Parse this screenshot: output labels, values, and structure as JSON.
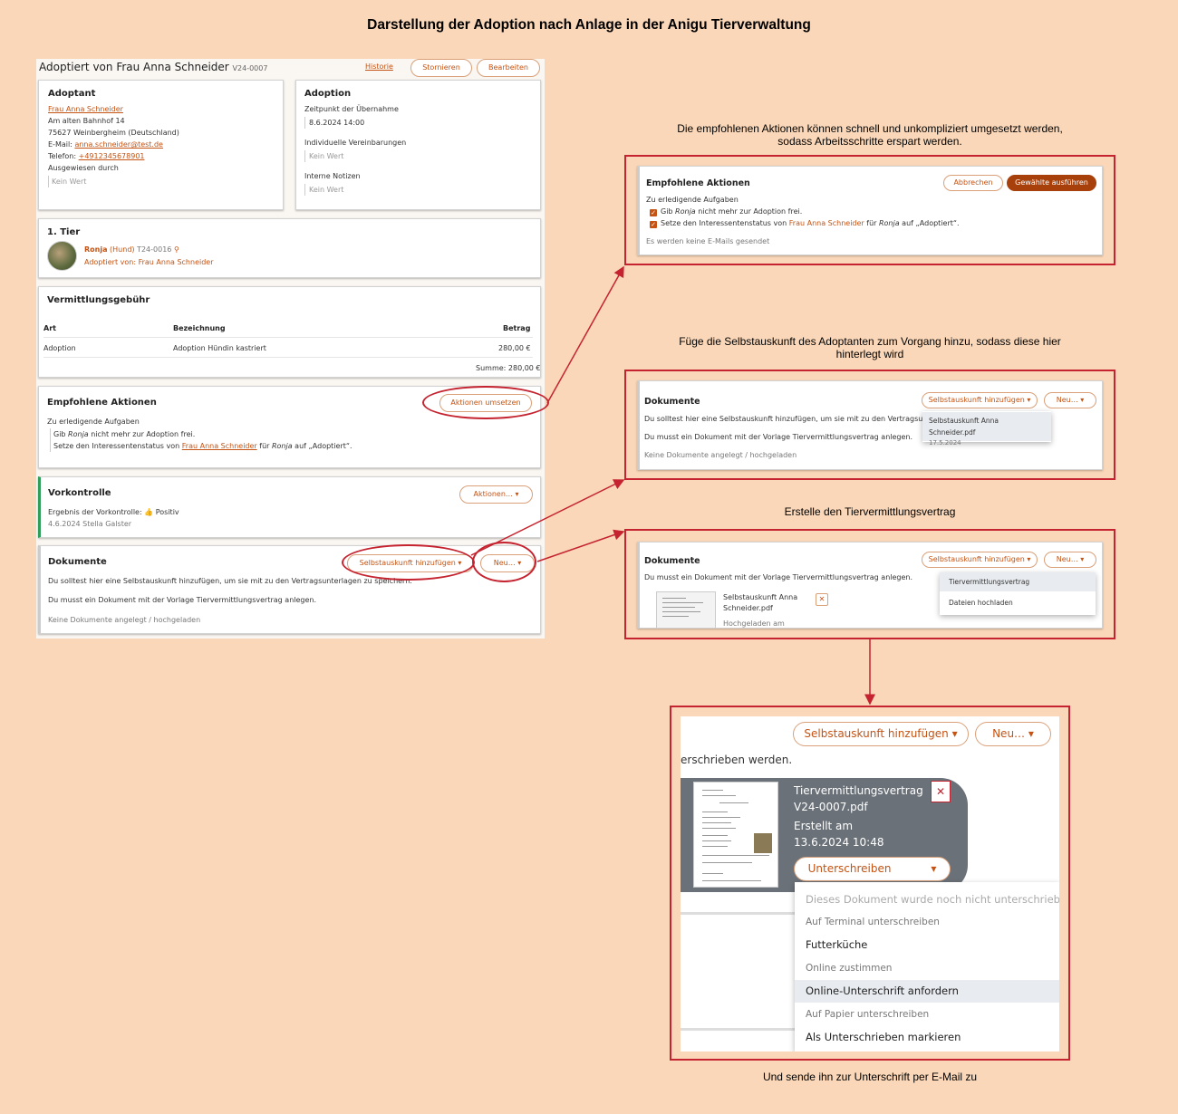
{
  "title": "Darstellung der Adoption nach Anlage in der Anigu Tierverwaltung",
  "main": {
    "heading": "Adoptiert von Frau Anna Schneider",
    "record_id": "V24-0007",
    "link_history": "Historie",
    "btn_cancel": "Stornieren",
    "btn_edit": "Bearbeiten",
    "adopter": {
      "title": "Adoptant",
      "name": "Frau Anna Schneider",
      "street": "Am alten Bahnhof 14",
      "city": "75627 Weinbergheim (Deutschland)",
      "email_label": "E-Mail:",
      "email": "anna.schneider@test.de",
      "phone_label": "Telefon:",
      "phone": "+4912345678901",
      "id_label": "Ausgewiesen durch",
      "id_value": "Kein Wert"
    },
    "adoption": {
      "title": "Adoption",
      "time_label": "Zeitpunkt der Übernahme",
      "time_value": "8.6.2024 14:00",
      "agreements_label": "Individuelle Vereinbarungen",
      "agreements_value": "Kein Wert",
      "notes_label": "Interne Notizen",
      "notes_value": "Kein Wert"
    },
    "animal": {
      "title": "1. Tier",
      "name": "Ronja",
      "species": "(Hund)",
      "id": "T24-0016",
      "adopted_by": "Adoptiert von: Frau Anna Schneider"
    },
    "fee": {
      "title": "Vermittlungsgebühr",
      "col_type": "Art",
      "col_desc": "Bezeichnung",
      "col_amount": "Betrag",
      "row_type": "Adoption",
      "row_desc": "Adoption Hündin kastriert",
      "row_amount": "280,00 €",
      "sum": "Summe: 280,00 €"
    },
    "recommended": {
      "title": "Empfohlene Aktionen",
      "btn": "Aktionen umsetzen",
      "tasks_label": "Zu erledigende Aufgaben",
      "task1_pre": "Gib ",
      "task1_em": "Ronja",
      "task1_post": " nicht mehr zur Adoption frei.",
      "task2_pre": "Setze den Interessentenstatus von ",
      "task2_link": "Frau Anna Schneider",
      "task2_mid": " für ",
      "task2_em": "Ronja",
      "task2_post": " auf „Adoptiert“."
    },
    "precheck": {
      "title": "Vorkontrolle",
      "btn": "Aktionen…",
      "result_label": "Ergebnis der Vorkontrolle:",
      "result_value": "Positiv",
      "meta": "4.6.2024 Stella Galster"
    },
    "documents": {
      "title": "Dokumente",
      "btn_self": "Selbstauskunft hinzufügen",
      "btn_new": "Neu…",
      "hint1": "Du solltest hier eine Selbstauskunft hinzufügen, um sie mit zu den Vertragsunterlagen zu speichern.",
      "hint2": "Du musst ein Dokument mit der Vorlage Tiervermittlungsvertrag anlegen.",
      "empty": "Keine Dokumente angelegt / hochgeladen"
    }
  },
  "callout1": {
    "caption": "Die empfohlenen Aktionen können schnell und unkompliziert umgesetzt werden, sodass Arbeitsschritte erspart werden.",
    "title": "Empfohlene Aktionen",
    "btn_abort": "Abbrechen",
    "btn_run": "Gewählte ausführen",
    "tasks_label": "Zu erledigende Aufgaben",
    "task1_pre": "Gib ",
    "task1_em": "Ronja",
    "task1_post": " nicht mehr zur Adoption frei.",
    "task2_pre": "Setze den Interessentenstatus von ",
    "task2_link": "Frau Anna Schneider",
    "task2_mid": " für ",
    "task2_em": "Ronja",
    "task2_post": " auf „Adoptiert“.",
    "no_mail": "Es werden keine E-Mails gesendet"
  },
  "callout2": {
    "caption": "Füge die Selbstauskunft des Adoptanten zum Vorgang hinzu, sodass diese hier hinterlegt wird",
    "title": "Dokumente",
    "btn_self": "Selbstauskunft hinzufügen",
    "btn_new": "Neu…",
    "hint1": "Du solltest hier eine Selbstauskunft hinzufügen, um sie mit zu den Vertragsunterlage",
    "hint2": "Du musst ein Dokument mit der Vorlage Tiervermittlungsvertrag anlegen.",
    "empty": "Keine Dokumente angelegt / hochgeladen",
    "dd_file": "Selbstauskunft Anna Schneider.pdf",
    "dd_date": "17.5.2024"
  },
  "callout3": {
    "caption": "Erstelle den Tiervermittlungsvertrag",
    "title": "Dokumente",
    "btn_self": "Selbstauskunft hinzufügen",
    "btn_new": "Neu…",
    "hint": "Du musst ein Dokument mit der Vorlage Tiervermittlungsvertrag anlegen.",
    "file_name": "Selbstauskunft Anna Schneider.pdf",
    "uploaded": "Hochgeladen am",
    "dd_item1": "Tiervermittlungsvertrag",
    "dd_item2": "Dateien hochladen"
  },
  "callout4": {
    "caption": "Und sende ihn zur Unterschrift per E-Mail zu",
    "btn_self": "Selbstauskunft hinzufügen",
    "btn_new": "Neu…",
    "text_fragment": "erschrieben werden.",
    "doc_name": "Tiervermittlungsvertrag V24-0007.pdf",
    "created_label": "Erstellt am",
    "created_value": "13.6.2024 10:48",
    "btn_sign": "Unterschreiben",
    "menu": [
      "Dieses Dokument wurde noch nicht unterschrieben",
      "Auf Terminal unterschreiben",
      "Futterküche",
      "Online zustimmen",
      "Online-Unterschrift anfordern",
      "Auf Papier unterschreiben",
      "Als Unterschrieben markieren"
    ]
  },
  "colors": {
    "background": "#fad7b8",
    "accent": "#c45314",
    "highlight": "#c4232f",
    "green": "#2f9e5a"
  }
}
